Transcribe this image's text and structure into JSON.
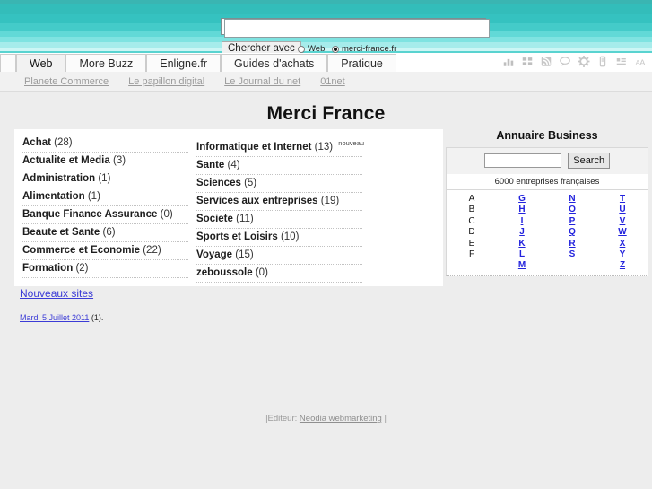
{
  "banner": {
    "search": {
      "value": "",
      "placeholder": "",
      "submit_label": "Chercher avec",
      "scopes": [
        {
          "label": "Web",
          "selected": false
        },
        {
          "label": "merci-france.fr",
          "selected": true
        }
      ]
    }
  },
  "tabs": [
    {
      "label": "Web",
      "active": true
    },
    {
      "label": "More Buzz",
      "active": false
    },
    {
      "label": "Enligne.fr",
      "active": false
    },
    {
      "label": "Guides d'achats",
      "active": false
    },
    {
      "label": "Pratique",
      "active": false
    }
  ],
  "toolbar_icons": [
    "bar-chart-icon",
    "grid-blocks-icon",
    "rss-feed-icon",
    "comment-bubble-icon",
    "gear-icon",
    "mobile-device-icon",
    "list-view-icon",
    "text-size-icon"
  ],
  "sublinks": [
    {
      "label": "Planete Commerce"
    },
    {
      "label": "Le papillon digital"
    },
    {
      "label": "Le Journal du net"
    },
    {
      "label": "01net"
    }
  ],
  "page": {
    "title": "Merci France"
  },
  "categories": {
    "column_left": [
      {
        "name": "Achat",
        "count": "(28)",
        "badge": ""
      },
      {
        "name": "Actualite et Media",
        "count": "(3)",
        "badge": ""
      },
      {
        "name": "Administration",
        "count": "(1)",
        "badge": ""
      },
      {
        "name": "Alimentation",
        "count": "(1)",
        "badge": ""
      },
      {
        "name": "Banque Finance Assurance",
        "count": "(0)",
        "badge": ""
      },
      {
        "name": "Beaute et Sante",
        "count": "(6)",
        "badge": ""
      },
      {
        "name": "Commerce et Economie",
        "count": "(22)",
        "badge": ""
      },
      {
        "name": "Formation",
        "count": "(2)",
        "badge": ""
      }
    ],
    "column_right": [
      {
        "name": "Informatique et Internet",
        "count": "(13)",
        "badge": "nouveau"
      },
      {
        "name": "Sante",
        "count": "(4)",
        "badge": ""
      },
      {
        "name": "Sciences",
        "count": "(5)",
        "badge": ""
      },
      {
        "name": "Services aux entreprises",
        "count": "(19)",
        "badge": ""
      },
      {
        "name": "Societe",
        "count": "(11)",
        "badge": ""
      },
      {
        "name": "Sports et Loisirs",
        "count": "(10)",
        "badge": ""
      },
      {
        "name": "Voyage",
        "count": "(15)",
        "badge": ""
      },
      {
        "name": "zeboussole",
        "count": "(0)",
        "badge": ""
      }
    ]
  },
  "annuaire": {
    "title": "Annuaire Business",
    "search_value": "",
    "search_button": "Search",
    "count_text": "6000 entreprises françaises",
    "alpha_columns": [
      {
        "is_link": false,
        "letters": [
          "A",
          "B",
          "C",
          "D",
          "E",
          "F"
        ]
      },
      {
        "is_link": true,
        "letters": [
          "G",
          "H",
          "I",
          "J",
          "K",
          "L",
          "M"
        ]
      },
      {
        "is_link": true,
        "letters": [
          "N",
          "O",
          "P",
          "Q",
          "R",
          "S"
        ]
      },
      {
        "is_link": true,
        "letters": [
          "T",
          "U",
          "V",
          "W",
          "X",
          "Y",
          "Z"
        ]
      }
    ]
  },
  "new_sites": {
    "heading": "Nouveaux sites",
    "date_label": "Mardi 5 Juillet 2011",
    "date_count": " (1)."
  },
  "footer": {
    "prefix": "|Editeur: ",
    "editor_link": "Neodia webmarketing",
    "suffix": " |"
  },
  "colors": {
    "banner_teal": "#33bdba",
    "banner_light": "#ccf6f5",
    "link_blue": "#2222dd",
    "page_bg": "#ededed"
  }
}
